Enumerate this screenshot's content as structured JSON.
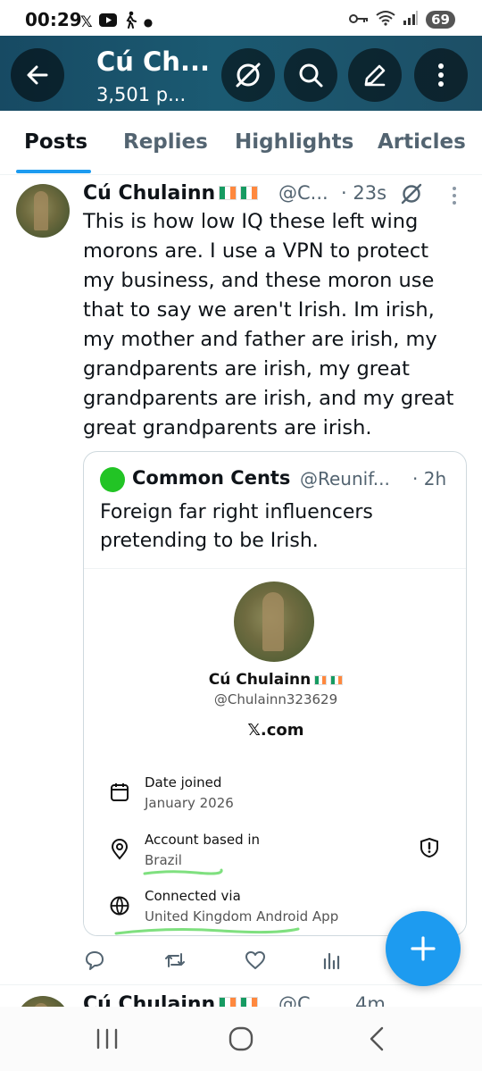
{
  "status_bar": {
    "time": "00:29",
    "battery": "69",
    "left_icons": [
      "x-logo-icon",
      "youtube-icon",
      "walking-icon",
      "dot-icon"
    ],
    "right_icons": [
      "key-icon",
      "wifi-icon",
      "signal-icon"
    ]
  },
  "header": {
    "title": "Cú Ch...",
    "subtitle": "3,501 p...",
    "background": "#1b5a72"
  },
  "tabs": [
    {
      "label": "Posts",
      "active": true
    },
    {
      "label": "Replies",
      "active": false
    },
    {
      "label": "Highlights",
      "active": false
    },
    {
      "label": "Articles",
      "active": false
    }
  ],
  "post": {
    "name": "Cú Chulainn",
    "handle": "@C...",
    "time": "· 23s",
    "text": "This is how low IQ these left wing morons are. I use a VPN to protect my business, and these moron use that to say we aren't Irish. Im irish, my mother and father are irish, my grandparents are irish, my great grandparents are irish, and my great great grandparents are irish.",
    "quote": {
      "name": "Common Cents",
      "handle": "@Reunif...",
      "time": "· 2h",
      "text": "Foreign far right influencers pretending to be Irish.",
      "image": {
        "profile_name": "Cú Chulainn",
        "profile_handle": "@Chulainn323629",
        "site": "𝕏.com",
        "rows": [
          {
            "label": "Date joined",
            "value": "January 2026",
            "icon": "calendar-icon"
          },
          {
            "label": "Account based in",
            "value": "Brazil",
            "icon": "location-pin-icon"
          },
          {
            "label": "Connected via",
            "value": "United Kingdom Android App",
            "icon": "globe-icon"
          }
        ]
      }
    }
  },
  "next_post": {
    "name": "Cú Chulainn",
    "handle": "@C...",
    "time": "4m"
  },
  "colors": {
    "accent": "#1d9bf0",
    "secondary_text": "#536471",
    "green_dot": "#22c425",
    "highlighter": "#7fe07f"
  }
}
